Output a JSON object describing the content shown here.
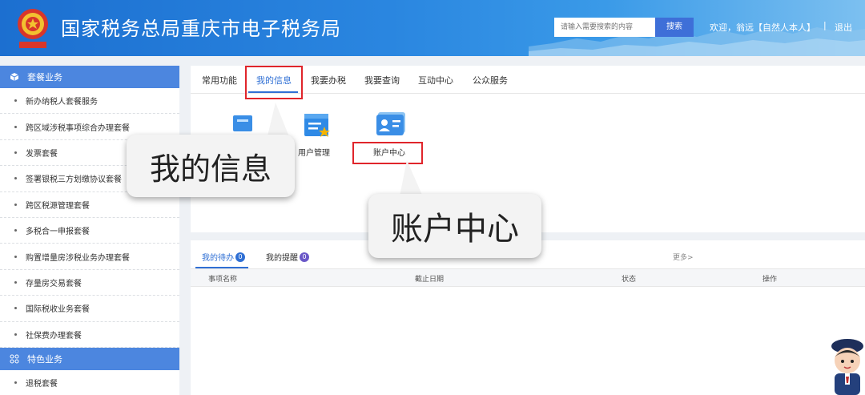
{
  "header": {
    "site_title": "国家税务总局重庆市电子税务局",
    "search_placeholder": "请输入需要搜索的内容",
    "search_button": "搜索",
    "welcome": "欢迎，翁远【自然人本人】",
    "separator": "|",
    "logout": "退出"
  },
  "sidebar": {
    "section1": {
      "icon": "cube-icon",
      "title": "套餐业务"
    },
    "items": [
      "新办纳税人套餐服务",
      "跨区域涉税事项综合办理套餐",
      "发票套餐",
      "签署银税三方划缴协议套餐",
      "跨区税源管理套餐",
      "多税合一申报套餐",
      "购置增量房涉税业务办理套餐",
      "存量房交易套餐",
      "国际税收业务套餐",
      "社保费办理套餐"
    ],
    "section2": {
      "icon": "grid-icon",
      "title": "特色业务"
    },
    "items2": [
      "退税套餐"
    ]
  },
  "tabs": {
    "items": [
      "常用功能",
      "我的信息",
      "我要办税",
      "我要查询",
      "互动中心",
      "公众服务"
    ],
    "active_index": 1
  },
  "functions": {
    "user_mgmt": {
      "label": "用户管理",
      "icon": "user-management-icon"
    },
    "account_center": {
      "label": "账户中心",
      "icon": "id-card-icon"
    }
  },
  "callouts": {
    "my_info": "我的信息",
    "account_center": "账户中心"
  },
  "todo": {
    "tab_pending": "我的待办",
    "pending_count": "0",
    "tab_reminders": "我的提醒",
    "reminder_count": "0",
    "more": "更多>",
    "columns": [
      "事项名称",
      "截止日期",
      "状态",
      "操作"
    ]
  },
  "colors": {
    "brand_blue": "#2f6fd4",
    "sidebar_header": "#4c86df",
    "highlight_red": "#e0252b",
    "badge_purple": "#6a58c8"
  }
}
